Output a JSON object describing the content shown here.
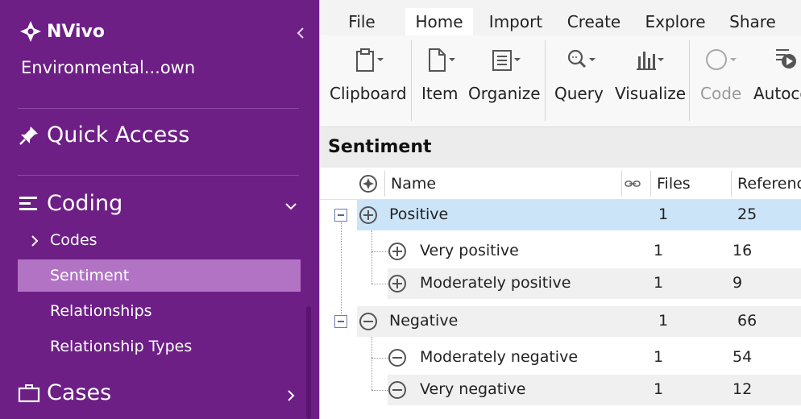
{
  "sidebar": {
    "app_name": "NVivo",
    "project": "Environmental...own",
    "quick_access": "Quick Access",
    "coding": "Coding",
    "coding_items": [
      "Codes",
      "Sentiment",
      "Relationships",
      "Relationship Types"
    ],
    "cases": "Cases"
  },
  "ribbon": {
    "tabs": [
      "File",
      "Home",
      "Import",
      "Create",
      "Explore",
      "Share"
    ],
    "active_tab": "Home",
    "groups": [
      "Clipboard",
      "Item",
      "Organize",
      "Query",
      "Visualize",
      "Code",
      "Autoco"
    ]
  },
  "list": {
    "title": "Sentiment",
    "columns": [
      "Name",
      "Files",
      "Referenc"
    ],
    "rows": [
      {
        "name": "Positive",
        "files": "1",
        "refs": "25"
      },
      {
        "name": "Very positive",
        "files": "1",
        "refs": "16"
      },
      {
        "name": "Moderately positive",
        "files": "1",
        "refs": "9"
      },
      {
        "name": "Negative",
        "files": "1",
        "refs": "66"
      },
      {
        "name": "Moderately negative",
        "files": "1",
        "refs": "54"
      },
      {
        "name": "Very negative",
        "files": "1",
        "refs": "12"
      }
    ]
  },
  "colors": {
    "sidebar": "#6d1f86",
    "sidebar_active": "#b273c4",
    "row_selected": "#cce4f7"
  }
}
